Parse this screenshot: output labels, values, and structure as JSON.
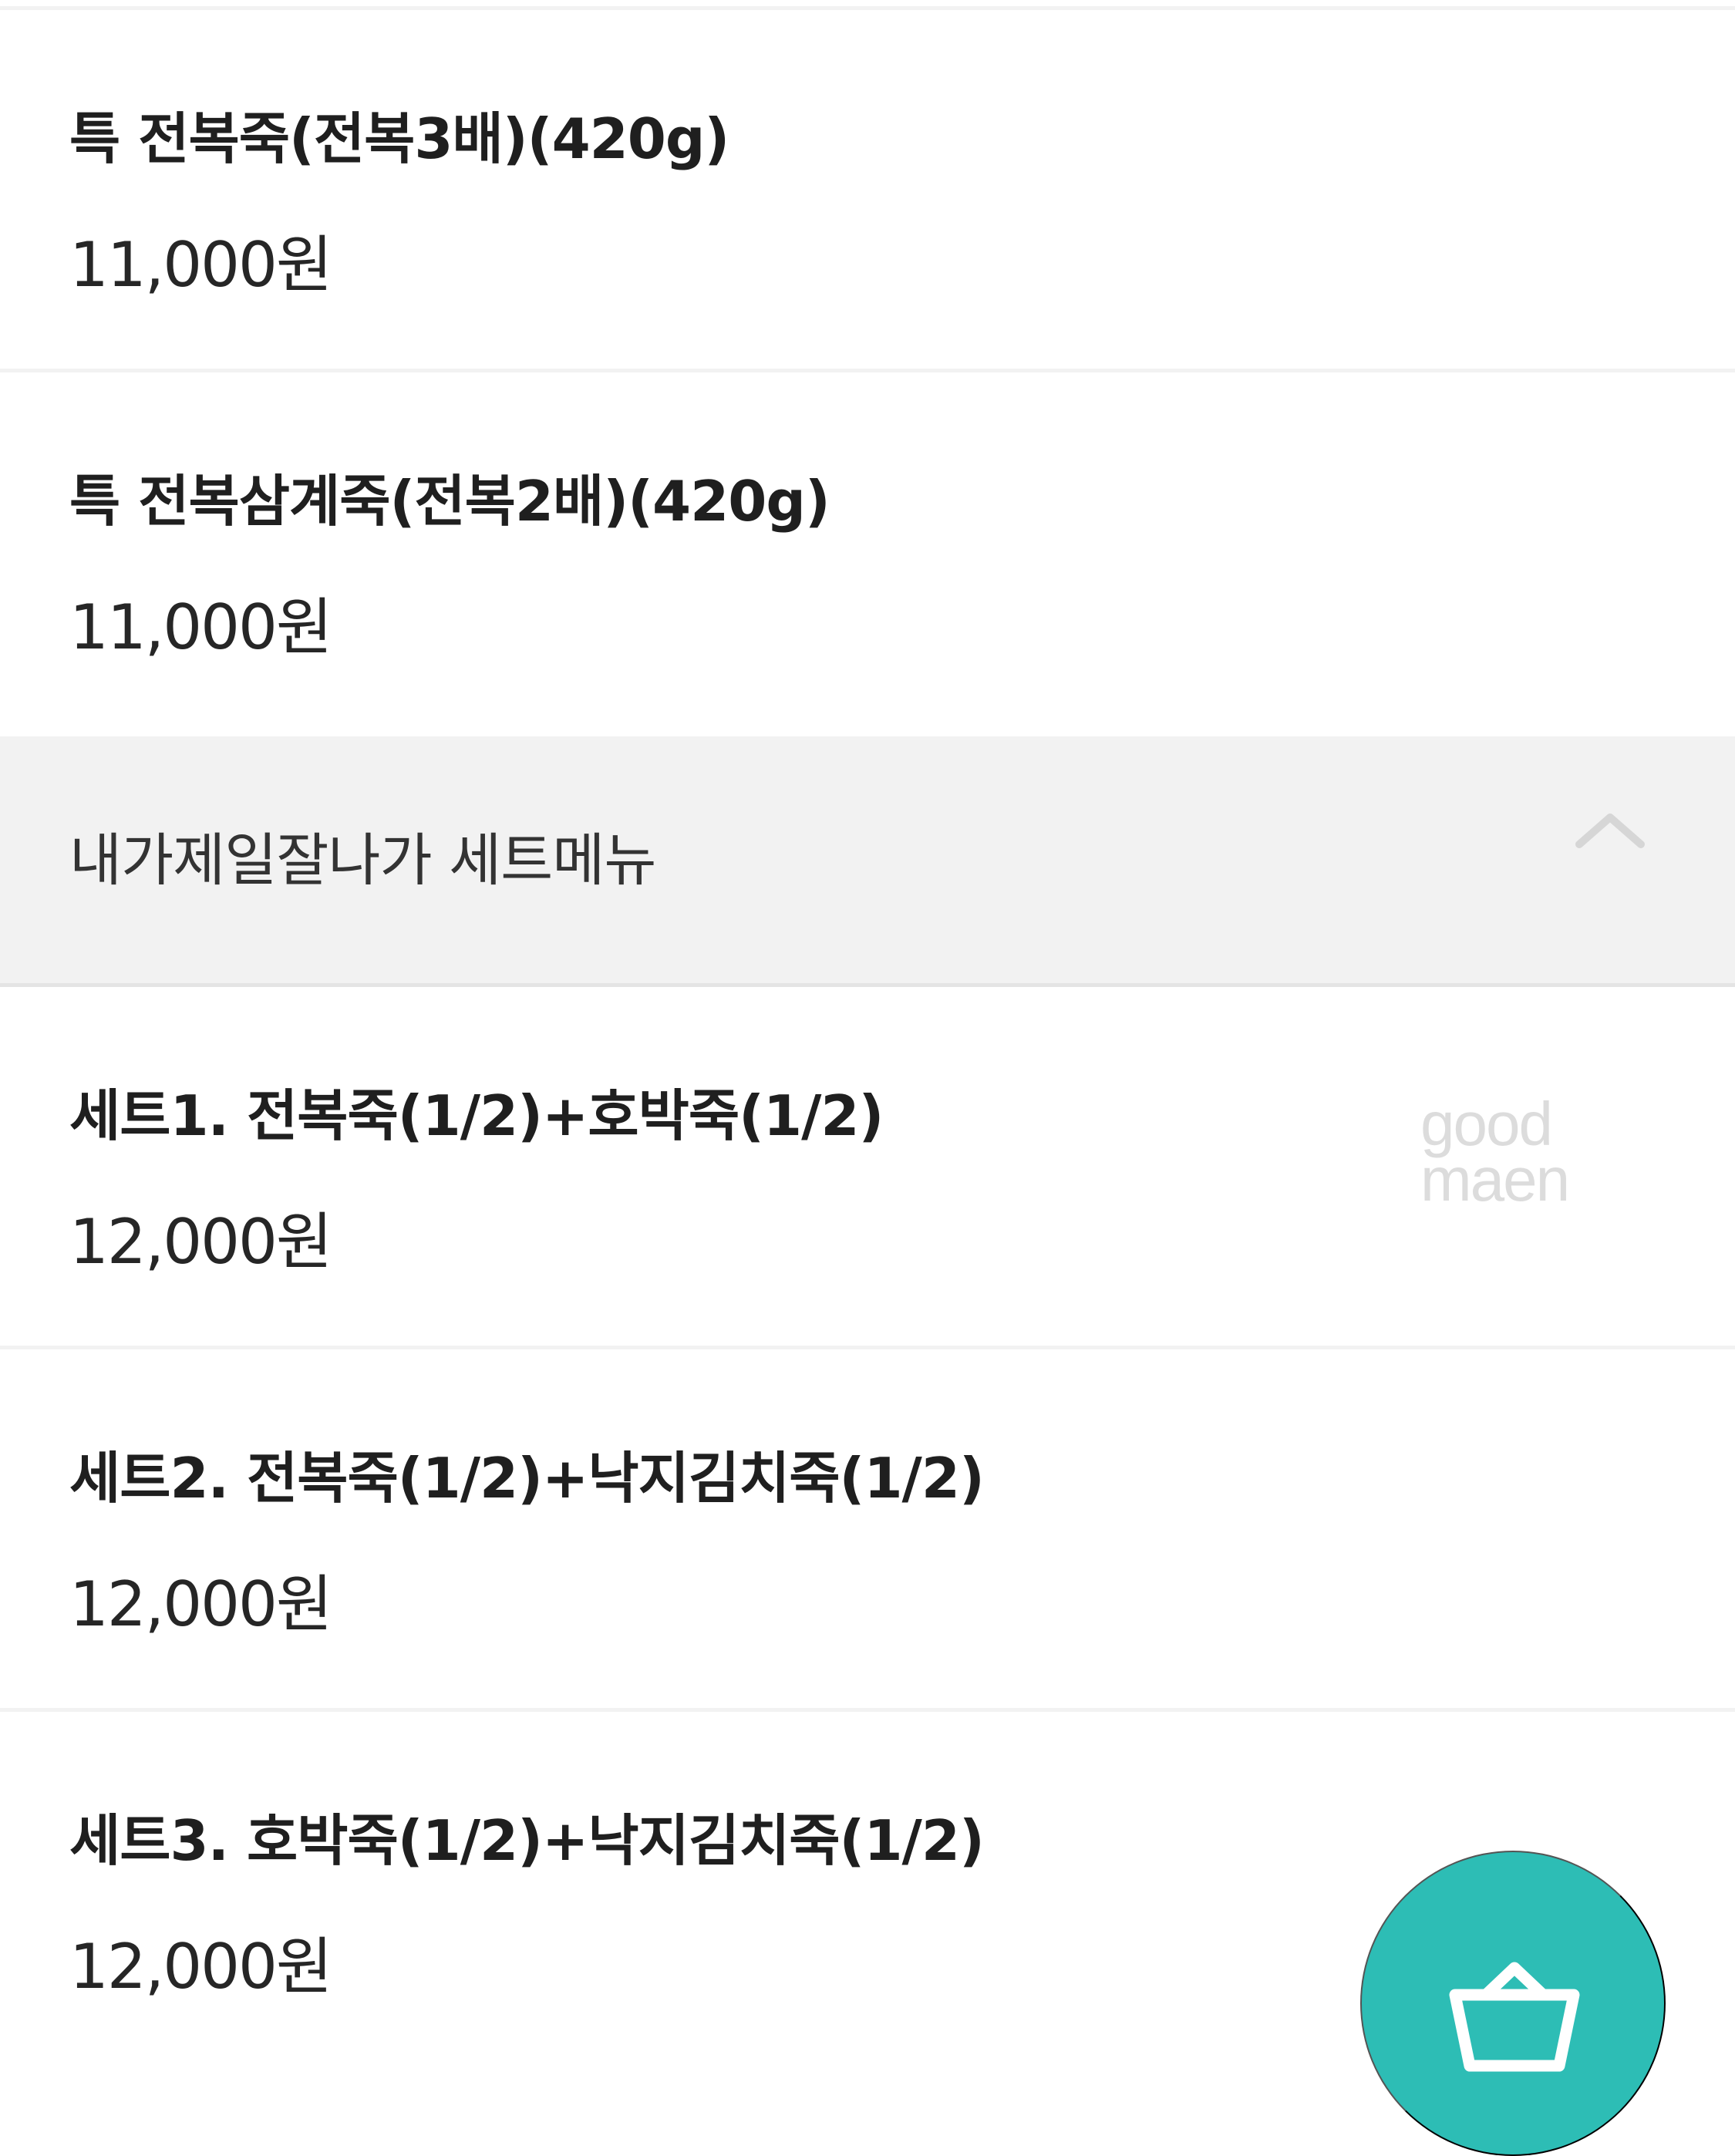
{
  "menu": {
    "top_items": [
      {
        "name": "특 전복죽(전복3배)(420g)",
        "price": "11,000원"
      },
      {
        "name": "특 전복삼계죽(전복2배)(420g)",
        "price": "11,000원"
      }
    ],
    "section": {
      "title": "내가제일잘나가 세트메뉴",
      "toggle_icon": "chevron-up-icon",
      "items": [
        {
          "name": "세트1. 전복죽(1/2)+호박죽(1/2)",
          "price": "12,000원"
        },
        {
          "name": "세트2. 전복죽(1/2)+낙지김치죽(1/2)",
          "price": "12,000원"
        },
        {
          "name": "세트3. 호박죽(1/2)+낙지김치죽(1/2)",
          "price": "12,000원"
        }
      ]
    }
  },
  "watermark": {
    "line1": "good",
    "line2": "maen"
  },
  "cart_button": {
    "icon": "shopping-basket-icon",
    "color": "#2dbdb5"
  },
  "colors": {
    "section_background": "#f2f2f2",
    "text": "#1f1f1f",
    "muted_icon": "#d6d6d6"
  }
}
